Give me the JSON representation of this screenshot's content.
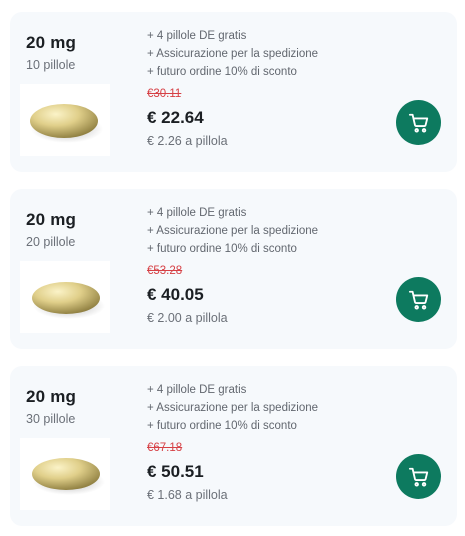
{
  "colors": {
    "card_bg": "#f6f9fc",
    "cart_button": "#0d7a5f",
    "old_price": "#d64045"
  },
  "products": [
    {
      "dose": "20 mg",
      "count": "10 pillole",
      "perks": [
        "+ 4 pillole DE gratis",
        "+ Assicurazione per la spedizione",
        "+ futuro ordine 10% di sconto"
      ],
      "old_price": "€30.11",
      "price": "€ 22.64",
      "unit_price": "€ 2.26 a pillola",
      "cart_icon": "cart-icon"
    },
    {
      "dose": "20 mg",
      "count": "20 pillole",
      "perks": [
        "+ 4 pillole DE gratis",
        "+ Assicurazione per la spedizione",
        "+ futuro ordine 10% di sconto"
      ],
      "old_price": "€53.28",
      "price": "€ 40.05",
      "unit_price": "€ 2.00 a pillola",
      "cart_icon": "cart-icon"
    },
    {
      "dose": "20 mg",
      "count": "30 pillole",
      "perks": [
        "+ 4 pillole DE gratis",
        "+ Assicurazione per la spedizione",
        "+ futuro ordine 10% di sconto"
      ],
      "old_price": "€67.18",
      "price": "€ 50.51",
      "unit_price": "€ 1.68 a pillola",
      "cart_icon": "cart-icon"
    }
  ]
}
